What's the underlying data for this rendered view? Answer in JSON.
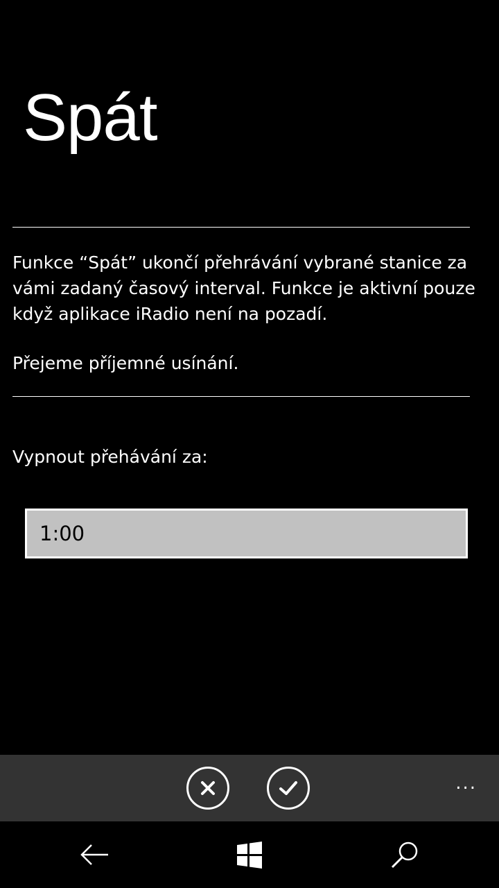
{
  "page": {
    "title": "Spát",
    "description": "Funkce “Spát” ukončí přehrávání vybrané stanice za vámi zadaný časový interval. Funkce je aktivní pouze když aplikace iRadio není na pozadí.",
    "note": "Přejeme příjemné usínání.",
    "field_label": "Vypnout přehávání za:",
    "time_value": "1:00"
  },
  "appbar": {
    "buttons": [
      {
        "icon": "cancel-icon"
      },
      {
        "icon": "check-icon"
      }
    ],
    "more_label": "..."
  },
  "navbar": {
    "icons": [
      "back-arrow-icon",
      "windows-start-icon",
      "search-icon"
    ]
  },
  "colors": {
    "background": "#000000",
    "text": "#ffffff",
    "appbar": "#333333",
    "input_fill": "#c1c1c1"
  }
}
